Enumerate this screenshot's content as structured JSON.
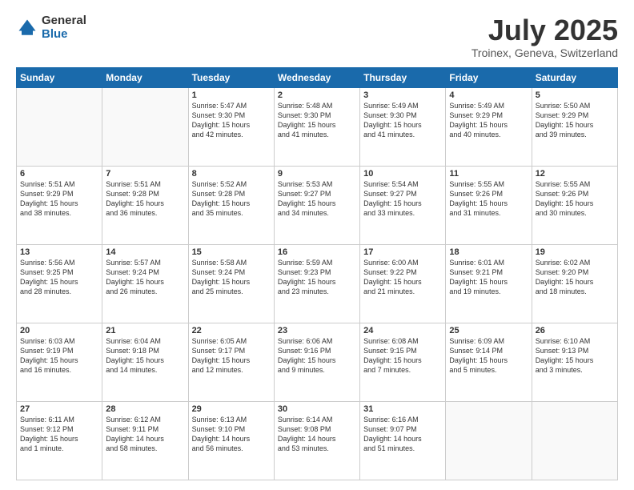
{
  "logo": {
    "general": "General",
    "blue": "Blue"
  },
  "title": "July 2025",
  "subtitle": "Troinex, Geneva, Switzerland",
  "days_of_week": [
    "Sunday",
    "Monday",
    "Tuesday",
    "Wednesday",
    "Thursday",
    "Friday",
    "Saturday"
  ],
  "weeks": [
    [
      {
        "day": "",
        "info": ""
      },
      {
        "day": "",
        "info": ""
      },
      {
        "day": "1",
        "info": "Sunrise: 5:47 AM\nSunset: 9:30 PM\nDaylight: 15 hours\nand 42 minutes."
      },
      {
        "day": "2",
        "info": "Sunrise: 5:48 AM\nSunset: 9:30 PM\nDaylight: 15 hours\nand 41 minutes."
      },
      {
        "day": "3",
        "info": "Sunrise: 5:49 AM\nSunset: 9:30 PM\nDaylight: 15 hours\nand 41 minutes."
      },
      {
        "day": "4",
        "info": "Sunrise: 5:49 AM\nSunset: 9:29 PM\nDaylight: 15 hours\nand 40 minutes."
      },
      {
        "day": "5",
        "info": "Sunrise: 5:50 AM\nSunset: 9:29 PM\nDaylight: 15 hours\nand 39 minutes."
      }
    ],
    [
      {
        "day": "6",
        "info": "Sunrise: 5:51 AM\nSunset: 9:29 PM\nDaylight: 15 hours\nand 38 minutes."
      },
      {
        "day": "7",
        "info": "Sunrise: 5:51 AM\nSunset: 9:28 PM\nDaylight: 15 hours\nand 36 minutes."
      },
      {
        "day": "8",
        "info": "Sunrise: 5:52 AM\nSunset: 9:28 PM\nDaylight: 15 hours\nand 35 minutes."
      },
      {
        "day": "9",
        "info": "Sunrise: 5:53 AM\nSunset: 9:27 PM\nDaylight: 15 hours\nand 34 minutes."
      },
      {
        "day": "10",
        "info": "Sunrise: 5:54 AM\nSunset: 9:27 PM\nDaylight: 15 hours\nand 33 minutes."
      },
      {
        "day": "11",
        "info": "Sunrise: 5:55 AM\nSunset: 9:26 PM\nDaylight: 15 hours\nand 31 minutes."
      },
      {
        "day": "12",
        "info": "Sunrise: 5:55 AM\nSunset: 9:26 PM\nDaylight: 15 hours\nand 30 minutes."
      }
    ],
    [
      {
        "day": "13",
        "info": "Sunrise: 5:56 AM\nSunset: 9:25 PM\nDaylight: 15 hours\nand 28 minutes."
      },
      {
        "day": "14",
        "info": "Sunrise: 5:57 AM\nSunset: 9:24 PM\nDaylight: 15 hours\nand 26 minutes."
      },
      {
        "day": "15",
        "info": "Sunrise: 5:58 AM\nSunset: 9:24 PM\nDaylight: 15 hours\nand 25 minutes."
      },
      {
        "day": "16",
        "info": "Sunrise: 5:59 AM\nSunset: 9:23 PM\nDaylight: 15 hours\nand 23 minutes."
      },
      {
        "day": "17",
        "info": "Sunrise: 6:00 AM\nSunset: 9:22 PM\nDaylight: 15 hours\nand 21 minutes."
      },
      {
        "day": "18",
        "info": "Sunrise: 6:01 AM\nSunset: 9:21 PM\nDaylight: 15 hours\nand 19 minutes."
      },
      {
        "day": "19",
        "info": "Sunrise: 6:02 AM\nSunset: 9:20 PM\nDaylight: 15 hours\nand 18 minutes."
      }
    ],
    [
      {
        "day": "20",
        "info": "Sunrise: 6:03 AM\nSunset: 9:19 PM\nDaylight: 15 hours\nand 16 minutes."
      },
      {
        "day": "21",
        "info": "Sunrise: 6:04 AM\nSunset: 9:18 PM\nDaylight: 15 hours\nand 14 minutes."
      },
      {
        "day": "22",
        "info": "Sunrise: 6:05 AM\nSunset: 9:17 PM\nDaylight: 15 hours\nand 12 minutes."
      },
      {
        "day": "23",
        "info": "Sunrise: 6:06 AM\nSunset: 9:16 PM\nDaylight: 15 hours\nand 9 minutes."
      },
      {
        "day": "24",
        "info": "Sunrise: 6:08 AM\nSunset: 9:15 PM\nDaylight: 15 hours\nand 7 minutes."
      },
      {
        "day": "25",
        "info": "Sunrise: 6:09 AM\nSunset: 9:14 PM\nDaylight: 15 hours\nand 5 minutes."
      },
      {
        "day": "26",
        "info": "Sunrise: 6:10 AM\nSunset: 9:13 PM\nDaylight: 15 hours\nand 3 minutes."
      }
    ],
    [
      {
        "day": "27",
        "info": "Sunrise: 6:11 AM\nSunset: 9:12 PM\nDaylight: 15 hours\nand 1 minute."
      },
      {
        "day": "28",
        "info": "Sunrise: 6:12 AM\nSunset: 9:11 PM\nDaylight: 14 hours\nand 58 minutes."
      },
      {
        "day": "29",
        "info": "Sunrise: 6:13 AM\nSunset: 9:10 PM\nDaylight: 14 hours\nand 56 minutes."
      },
      {
        "day": "30",
        "info": "Sunrise: 6:14 AM\nSunset: 9:08 PM\nDaylight: 14 hours\nand 53 minutes."
      },
      {
        "day": "31",
        "info": "Sunrise: 6:16 AM\nSunset: 9:07 PM\nDaylight: 14 hours\nand 51 minutes."
      },
      {
        "day": "",
        "info": ""
      },
      {
        "day": "",
        "info": ""
      }
    ]
  ]
}
